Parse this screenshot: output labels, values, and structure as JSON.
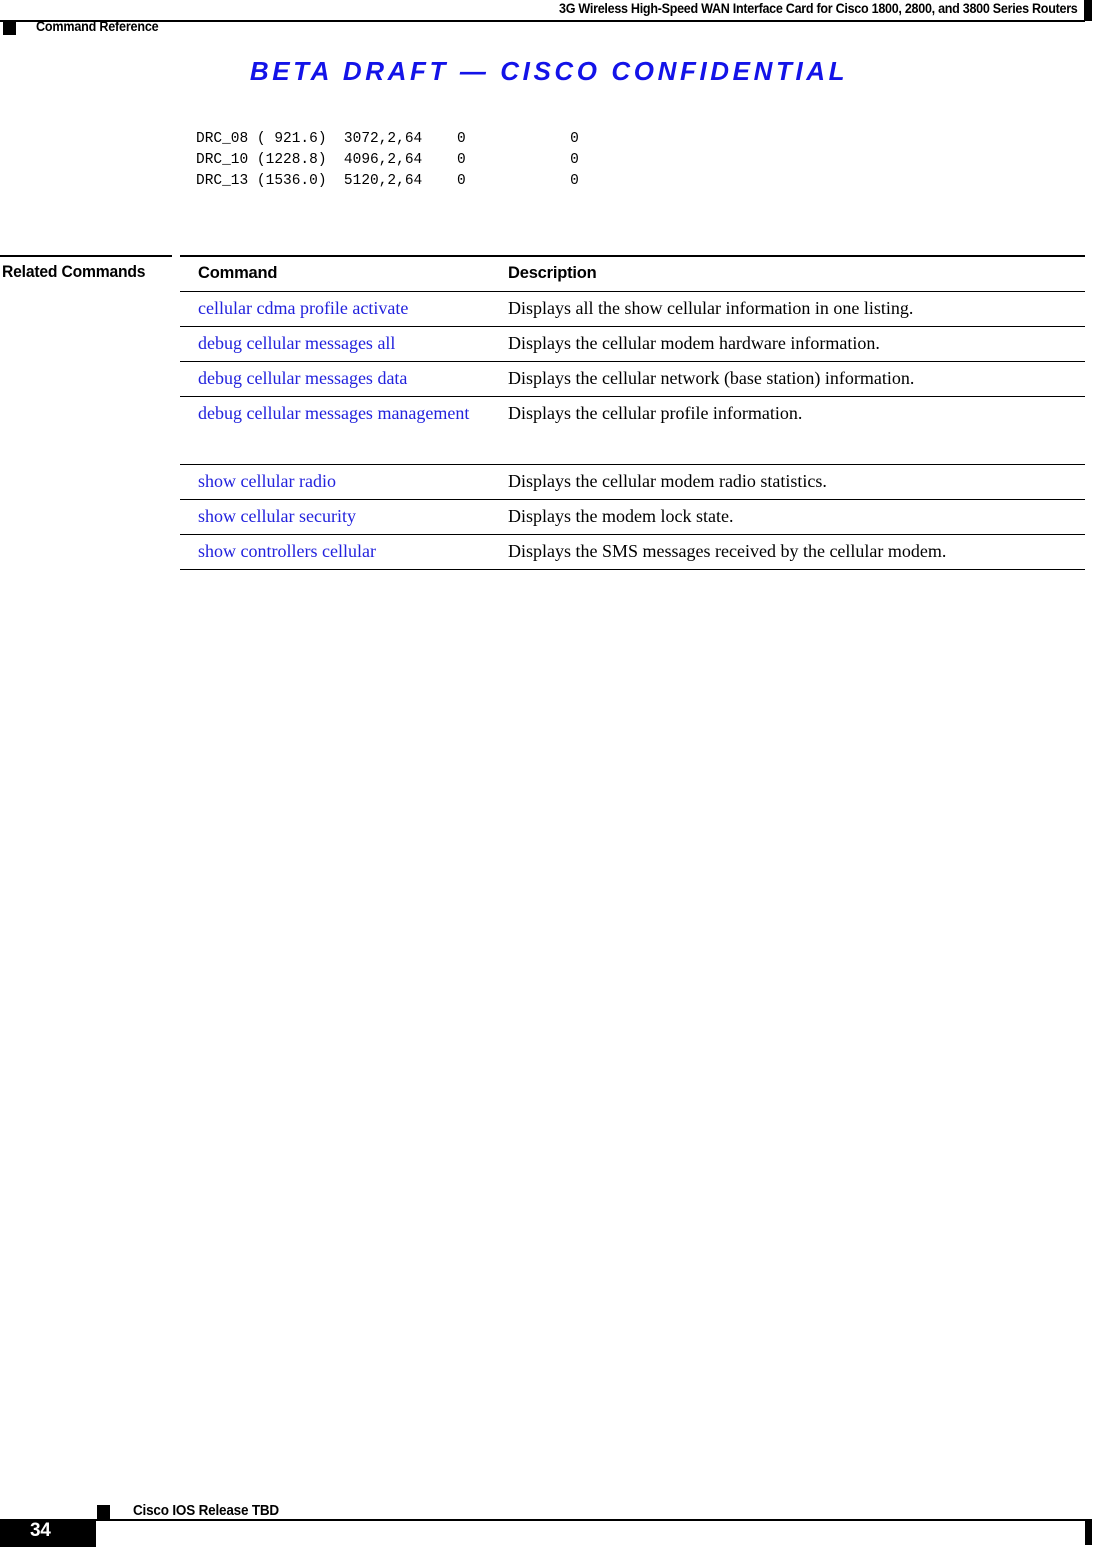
{
  "header": {
    "document_title": "3G Wireless High-Speed WAN Interface Card for Cisco 1800, 2800, and 3800 Series Routers",
    "chapter_title": "Command Reference"
  },
  "banner": {
    "text": "BETA DRAFT — CISCO CONFIDENTIAL"
  },
  "output_block": {
    "text": "DRC_08 ( 921.6)  3072,2,64    0            0\nDRC_10 (1228.8)  4096,2,64    0            0\nDRC_13 (1536.0)  5120,2,64    0            0"
  },
  "related_commands": {
    "label": "Related Commands",
    "columns": {
      "command": "Command",
      "description": "Description"
    },
    "rows": [
      {
        "command": "cellular cdma profile activate",
        "description": "Displays all the show cellular information in one listing."
      },
      {
        "command": "debug cellular messages all",
        "description": "Displays the cellular modem hardware information."
      },
      {
        "command": "debug cellular messages data",
        "description": "Displays the cellular network (base station) information."
      },
      {
        "command": "debug cellular messages management",
        "description": "Displays the cellular profile information."
      },
      {
        "command": "show cellular radio",
        "description": "Displays the cellular modem radio statistics."
      },
      {
        "command": "show cellular security",
        "description": "Displays the modem lock state."
      },
      {
        "command": "show controllers cellular",
        "description": "Displays the SMS messages received by the cellular modem."
      }
    ]
  },
  "footer": {
    "release": "Cisco IOS Release TBD",
    "page_number": "34"
  },
  "colors": {
    "link_blue": "#2222dd",
    "banner_blue": "#1313e8",
    "rule_black": "#000000"
  }
}
